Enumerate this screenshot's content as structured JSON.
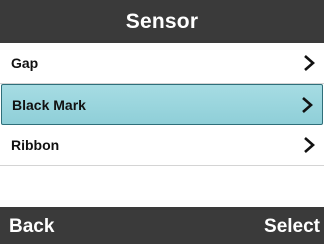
{
  "header": {
    "title": "Sensor"
  },
  "menu": {
    "items": [
      {
        "label": "Gap"
      },
      {
        "label": "Black Mark"
      },
      {
        "label": "Ribbon"
      }
    ],
    "selected_index": 1
  },
  "footer": {
    "back_label": "Back",
    "select_label": "Select"
  },
  "colors": {
    "bar_background": "#3a3a3a",
    "selected_highlight": "#9dd7df",
    "selected_border": "#2f6f7a"
  },
  "icons": {
    "item_arrow": "chevron-right-icon"
  }
}
